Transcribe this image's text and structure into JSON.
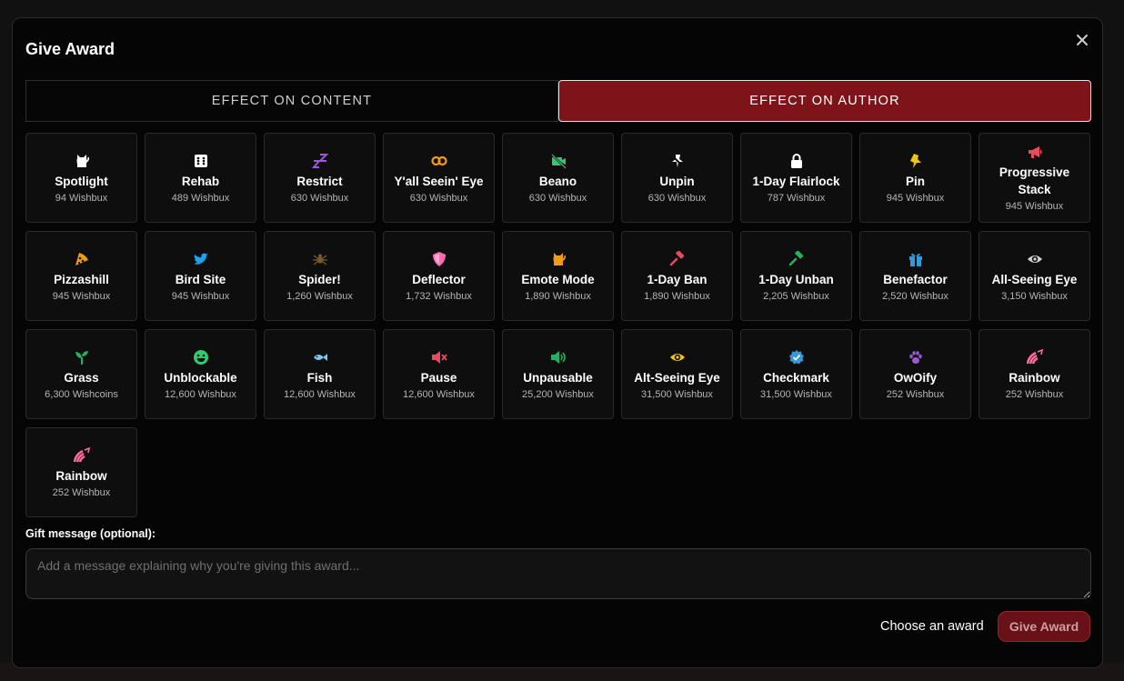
{
  "modal": {
    "title": "Give Award"
  },
  "tabs": [
    {
      "label": "EFFECT ON CONTENT",
      "active": false
    },
    {
      "label": "EFFECT ON AUTHOR",
      "active": true
    }
  ],
  "awards": [
    {
      "name": "Spotlight",
      "price": "94 Wishbux",
      "icon": "cat-icon",
      "color": "#ffffff"
    },
    {
      "name": "Rehab",
      "price": "489 Wishbux",
      "icon": "dice-icon",
      "color": "#ffffff"
    },
    {
      "name": "Restrict",
      "price": "630 Wishbux",
      "icon": "sleep-icon",
      "color": "#9b59d6"
    },
    {
      "name": "Y'all Seein' Eye",
      "price": "630 Wishbux",
      "icon": "eyes-icon",
      "color": "#f39c12"
    },
    {
      "name": "Beano",
      "price": "630 Wishbux",
      "icon": "no-camera-icon",
      "color": "#2ecc71"
    },
    {
      "name": "Unpin",
      "price": "630 Wishbux",
      "icon": "unpin-icon",
      "color": "#ffffff"
    },
    {
      "name": "1-Day Flairlock",
      "price": "787 Wishbux",
      "icon": "lock-icon",
      "color": "#ffffff"
    },
    {
      "name": "Pin",
      "price": "945 Wishbux",
      "icon": "pin-icon",
      "color": "#f1c40f"
    },
    {
      "name": "Progressive Stack",
      "price": "945 Wishbux",
      "icon": "megaphone-icon",
      "color": "#e74c5c"
    },
    {
      "name": "Pizzashill",
      "price": "945 Wishbux",
      "icon": "pizza-icon",
      "color": "#f39c12"
    },
    {
      "name": "Bird Site",
      "price": "945 Wishbux",
      "icon": "bird-icon",
      "color": "#1da1f2"
    },
    {
      "name": "Spider!",
      "price": "1,260 Wishbux",
      "icon": "spider-icon",
      "color": "#7a5a2a"
    },
    {
      "name": "Deflector",
      "price": "1,732 Wishbux",
      "icon": "shield-icon",
      "color": "#ff69b4"
    },
    {
      "name": "Emote Mode",
      "price": "1,890 Wishbux",
      "icon": "cat-icon",
      "color": "#f39c12"
    },
    {
      "name": "1-Day Ban",
      "price": "1,890 Wishbux",
      "icon": "gavel-icon",
      "color": "#e74c5c"
    },
    {
      "name": "1-Day Unban",
      "price": "2,205 Wishbux",
      "icon": "gavel-icon",
      "color": "#27ae60"
    },
    {
      "name": "Benefactor",
      "price": "2,520 Wishbux",
      "icon": "gift-icon",
      "color": "#3498db"
    },
    {
      "name": "All-Seeing Eye",
      "price": "3,150 Wishbux",
      "icon": "eye-icon",
      "color": "#d0d0d0"
    },
    {
      "name": "Grass",
      "price": "6,300 Wishcoins",
      "icon": "seedling-icon",
      "color": "#27ae60"
    },
    {
      "name": "Unblockable",
      "price": "12,600 Wishbux",
      "icon": "smile-icon",
      "color": "#2ecc71"
    },
    {
      "name": "Fish",
      "price": "12,600 Wishbux",
      "icon": "fish-icon",
      "color": "#7fc6e8"
    },
    {
      "name": "Pause",
      "price": "12,600 Wishbux",
      "icon": "mute-icon",
      "color": "#e74c5c"
    },
    {
      "name": "Unpausable",
      "price": "25,200 Wishbux",
      "icon": "volume-icon",
      "color": "#27ae60"
    },
    {
      "name": "Alt-Seeing Eye",
      "price": "31,500 Wishbux",
      "icon": "eye-icon",
      "color": "#f1c40f"
    },
    {
      "name": "Checkmark",
      "price": "31,500 Wishbux",
      "icon": "badge-check-icon",
      "color": "#3498db"
    },
    {
      "name": "OwOify",
      "price": "252 Wishbux",
      "icon": "paw-icon",
      "color": "#9b59d6"
    },
    {
      "name": "Rainbow",
      "price": "252 Wishbux",
      "icon": "rainbow-icon",
      "color": "#ff6b9d"
    },
    {
      "name": "Rainbow",
      "price": "252 Wishbux",
      "icon": "rainbow-icon",
      "color": "#ff6b9d"
    }
  ],
  "gift": {
    "label": "Gift message (optional):",
    "placeholder": "Add a message explaining why you're giving this award..."
  },
  "footer": {
    "status": "Choose an award",
    "submit_label": "Give Award"
  }
}
